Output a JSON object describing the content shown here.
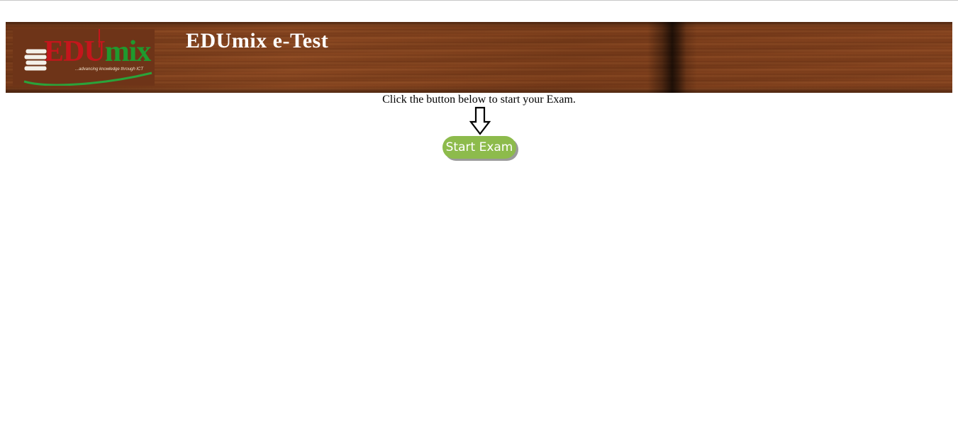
{
  "header": {
    "logo": {
      "text_edu": "EDU",
      "text_mix": "mix",
      "tagline": "...advancing knowledge through ICT",
      "colors": {
        "edu": "#c4161c",
        "mix": "#1f9a2e"
      }
    },
    "title": "EDUmix e-Test"
  },
  "main": {
    "instruction": "Click the button below to start your Exam.",
    "arrow_icon": "down-arrow-icon",
    "start_button_label": "Start Exam",
    "accent_color": "#8dbb4c"
  }
}
